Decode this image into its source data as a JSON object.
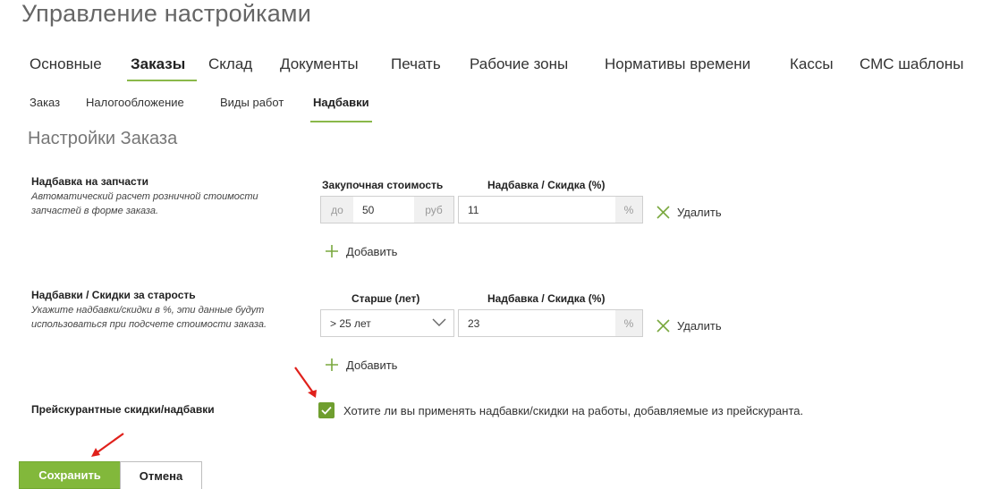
{
  "page": {
    "title": "Управление настройками"
  },
  "main_tabs": [
    {
      "label": "Основные"
    },
    {
      "label": "Заказы",
      "active": true
    },
    {
      "label": "Склад"
    },
    {
      "label": "Документы"
    },
    {
      "label": "Печать"
    },
    {
      "label": "Рабочие зоны"
    },
    {
      "label": "Нормативы времени"
    },
    {
      "label": "Кассы"
    },
    {
      "label": "СМС шаблоны"
    }
  ],
  "sub_tabs": [
    {
      "label": "Заказ"
    },
    {
      "label": "Налогообложение"
    },
    {
      "label": "Виды работ"
    },
    {
      "label": "Надбавки",
      "active": true
    }
  ],
  "section": {
    "title": "Настройки Заказа"
  },
  "parts_markup": {
    "label": "Надбавка на запчасти",
    "description": "Автоматический расчет розничной стоимости запчастей в форме заказа.",
    "col_cost": "Закупочная стоимость",
    "col_markup": "Надбавка / Скидка (%)",
    "prefix": "до",
    "cost_value": "50",
    "suffix": "руб",
    "markup_value": "11",
    "percent": "%",
    "delete_label": "Удалить",
    "add_label": "Добавить"
  },
  "age_markup": {
    "label": "Надбавки / Скидки за старость",
    "description": "Укажите надбавки/скидки в %, эти данные будут использоваться при подсчете стоимости заказа.",
    "col_age": "Старше (лет)",
    "col_markup": "Надбавка / Скидка (%)",
    "age_value": "> 25 лет",
    "markup_value": "23",
    "percent": "%",
    "delete_label": "Удалить",
    "add_label": "Добавить"
  },
  "pricelist": {
    "label": "Прейскурантные скидки/надбавки",
    "checkbox_label": "Хотите ли вы применять надбавки/скидки на работы, добавляемые из прейскуранта.",
    "checked": true
  },
  "buttons": {
    "save": "Сохранить",
    "cancel": "Отмена"
  },
  "colors": {
    "accent": "#82b83b",
    "checkbox": "#6f9e2f",
    "annotation_arrow": "#e0201b"
  },
  "icons": {
    "delete": "close-x-icon",
    "add": "plus-icon",
    "select": "chevron-down-icon",
    "check": "checkmark-icon"
  }
}
